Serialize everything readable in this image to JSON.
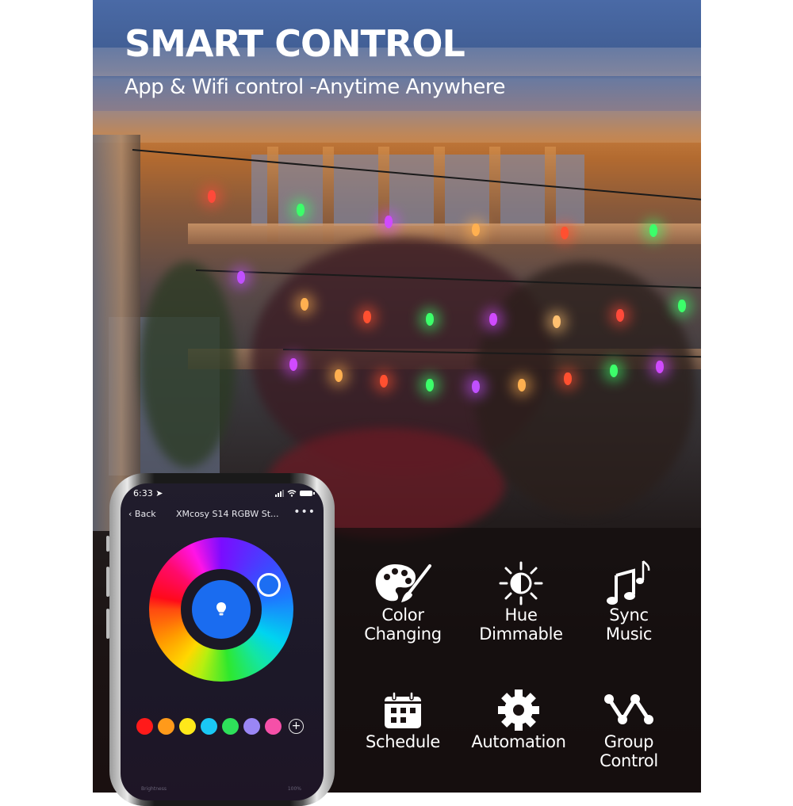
{
  "banner": {
    "headline": "SMART CONTROL",
    "subheadline": "App & Wifi control -Anytime Anywhere"
  },
  "phone": {
    "status_bar": {
      "time": "6:33",
      "icons": [
        "location-arrow-icon",
        "signal-icon",
        "wifi-icon",
        "battery-icon"
      ]
    },
    "nav": {
      "back_label": "Back",
      "title": "XMcosy S14 RGBW St...",
      "more_label": "•••"
    },
    "color_wheel": {
      "selected_color": "#1A6CF0",
      "center_icon": "lightbulb-icon"
    },
    "swatches": [
      {
        "name": "red",
        "color": "#FF1A1A"
      },
      {
        "name": "orange",
        "color": "#FF9A1A"
      },
      {
        "name": "yellow",
        "color": "#FFE81A"
      },
      {
        "name": "sky-blue",
        "color": "#1AC8F5"
      },
      {
        "name": "green",
        "color": "#2EE05A"
      },
      {
        "name": "lavender",
        "color": "#9A86F5"
      },
      {
        "name": "pink",
        "color": "#F550A8"
      }
    ],
    "add_swatch_label": "+",
    "brightness": {
      "label": "Brightness",
      "value": "100%"
    }
  },
  "features": [
    {
      "icon": "palette-icon",
      "label_line1": "Color",
      "label_line2": "Changing"
    },
    {
      "icon": "brightness-icon",
      "label_line1": "Hue",
      "label_line2": "Dimmable"
    },
    {
      "icon": "music-notes-icon",
      "label_line1": "Sync",
      "label_line2": "Music"
    },
    {
      "icon": "calendar-icon",
      "label_line1": "Schedule",
      "label_line2": ""
    },
    {
      "icon": "gear-icon",
      "label_line1": "Automation",
      "label_line2": ""
    },
    {
      "icon": "group-nodes-icon",
      "label_line1": "Group",
      "label_line2": "Control"
    }
  ],
  "scene": {
    "bulb_colors": [
      "#ff4a3a",
      "#3cff6a",
      "#d04aff",
      "#ffb050",
      "#ff5030",
      "#3cff6a",
      "#c050ff",
      "#ffb050",
      "#ff5030",
      "#3cff6a",
      "#d04aff",
      "#ffc070"
    ]
  }
}
